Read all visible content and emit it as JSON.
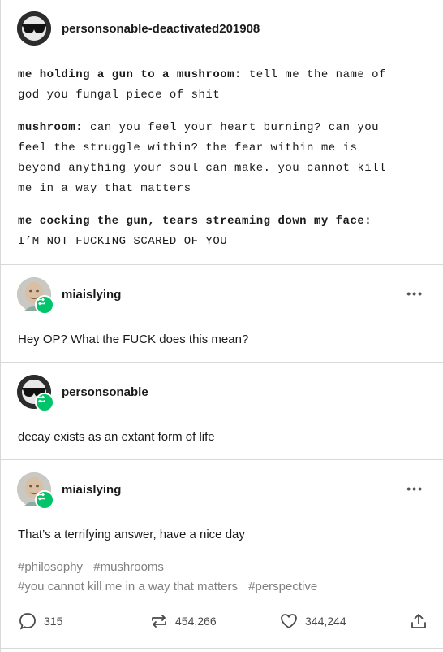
{
  "op": {
    "blog_name": "personsonable-deactivated201908",
    "lines": [
      {
        "speaker": "me holding a gun to a mushroom:",
        "text": " tell me the name of\ngod you fungal piece of shit"
      },
      {
        "speaker": "mushroom:",
        "text": " can you feel your heart burning? can you\nfeel the struggle within? the fear within me is\nbeyond anything your soul can make. you cannot kill\nme in a way that matters"
      },
      {
        "speaker": "me cocking the gun, tears streaming down my face:",
        "text": "\nI’M NOT FUCKING SCARED OF YOU"
      }
    ]
  },
  "replies": [
    {
      "blog_name": "miaislying",
      "text": "Hey OP? What the FUCK does this mean?",
      "more": "•••"
    },
    {
      "blog_name": "personsonable",
      "text": "decay exists as an extant form of life",
      "more": ""
    },
    {
      "blog_name": "miaislying",
      "text": "That’s a terrifying answer, have a nice day",
      "more": "•••"
    }
  ],
  "tags": [
    "#philosophy",
    "#mushrooms",
    "#you cannot kill me in a way that matters",
    "#perspective"
  ],
  "footer": {
    "comments": "315",
    "reblogs": "454,266",
    "likes": "344,244"
  },
  "colors": {
    "accent_green": "#00c46a",
    "tag_gray": "#808080",
    "divider": "#d9d9d9"
  },
  "icons": {
    "avatar_op": "sunglasses-avatar-icon",
    "avatar_mia": "meme-man-avatar-icon",
    "reblog_badge": "reblog-badge-icon",
    "comment": "comment-icon",
    "reblog": "reblog-icon",
    "like": "heart-icon",
    "share": "share-icon",
    "more": "more-icon"
  }
}
